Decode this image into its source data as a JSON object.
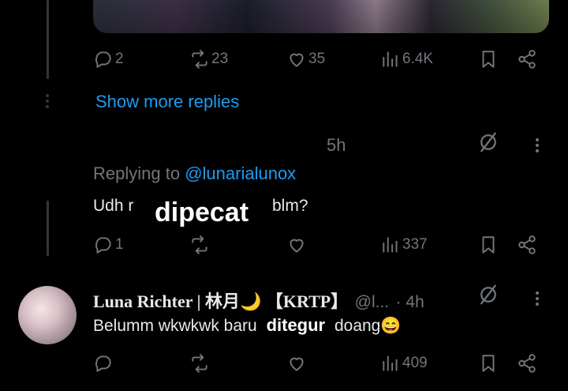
{
  "tweet_top": {
    "actions": {
      "replies": "2",
      "reposts": "23",
      "likes": "35",
      "views": "6.4K"
    }
  },
  "show_more_replies": "Show more replies",
  "reply_1": {
    "time": "5h",
    "replying_prefix": "Replying to",
    "replying_handle": "@lunarialunox",
    "text_left": "Udh r",
    "text_right": "blm?",
    "overlay_text": "dipecat",
    "actions": {
      "replies": "1",
      "views": "337"
    }
  },
  "reply_2": {
    "name": "Luna Richter | 林月🌙 【KRTP】",
    "handle": "@l...",
    "time": "· 4h",
    "text_before": "Belumm wkwkwk baru",
    "overlay_text": "ditegur",
    "text_after": "doang😄",
    "actions": {
      "views": "409"
    }
  },
  "colors": {
    "background": "#000000",
    "text": "#e7e9ea",
    "muted": "#71767b",
    "link": "#1d9bf0"
  }
}
